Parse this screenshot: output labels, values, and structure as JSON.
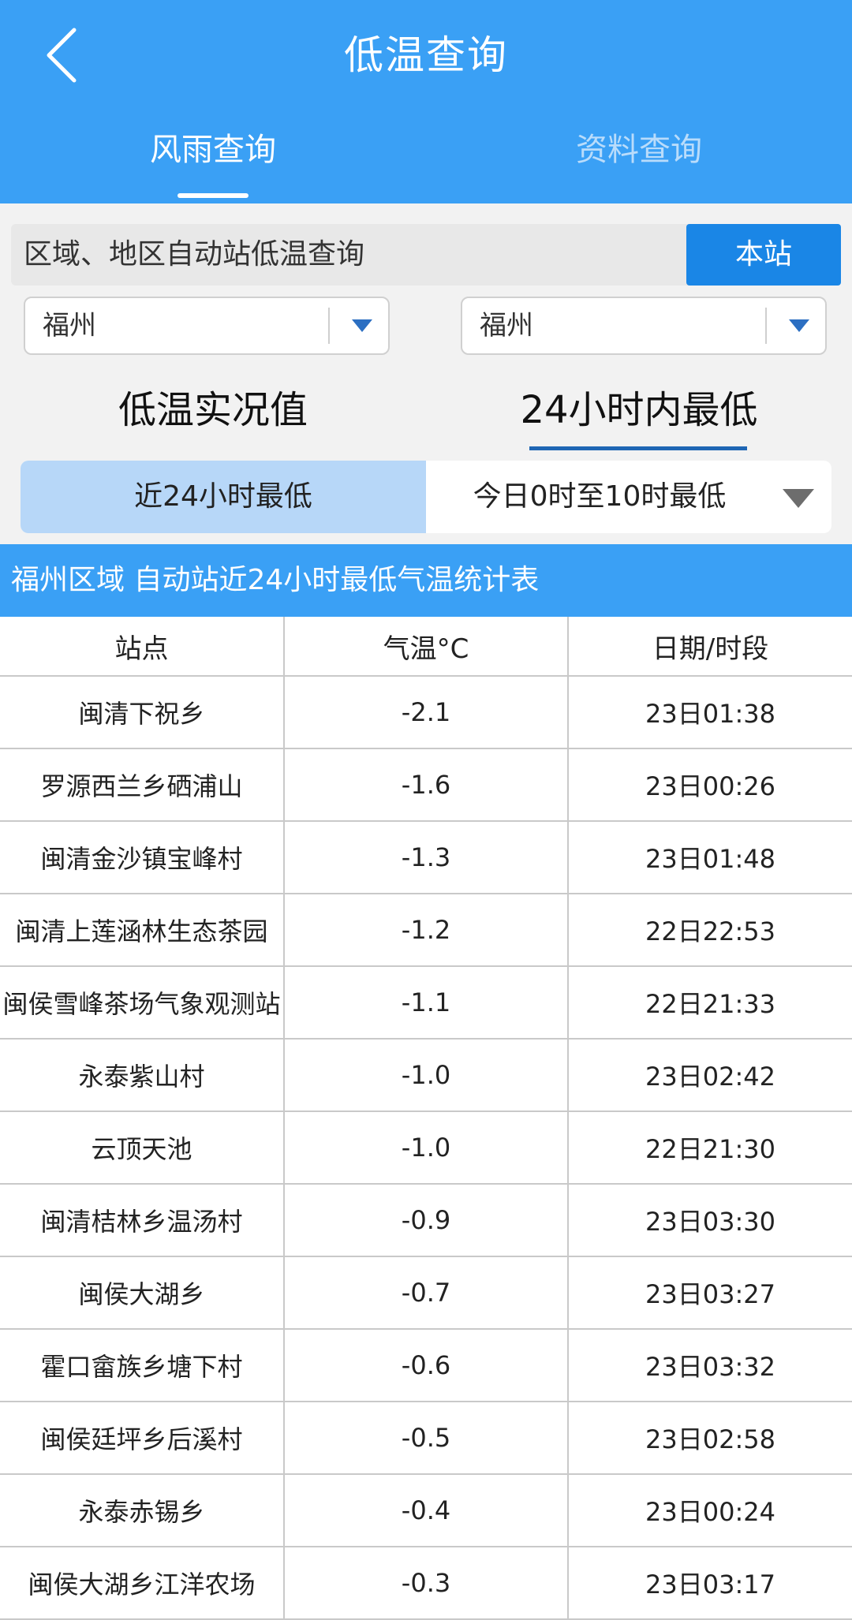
{
  "header": {
    "title": "低温查询",
    "tabs": [
      {
        "label": "风雨查询",
        "active": true
      },
      {
        "label": "资料查询",
        "active": false
      }
    ]
  },
  "search": {
    "label": "区域、地区自动站低温查询",
    "button_label": "本站"
  },
  "selects": {
    "left_value": "福州",
    "right_value": "福州"
  },
  "modes": {
    "left": "低温实况值",
    "right": "24小时内最低",
    "active": "right"
  },
  "range": {
    "left": "近24小时最低",
    "right": "今日0时至10时最低",
    "active": "left"
  },
  "table": {
    "title": "福州区域 自动站近24小时最低气温统计表",
    "headers": [
      "站点",
      "气温°C",
      "日期/时段"
    ],
    "rows": [
      [
        "闽清下祝乡",
        "-2.1",
        "23日01:38"
      ],
      [
        "罗源西兰乡硒浦山",
        "-1.6",
        "23日00:26"
      ],
      [
        "闽清金沙镇宝峰村",
        "-1.3",
        "23日01:48"
      ],
      [
        "闽清上莲涵林生态茶园",
        "-1.2",
        "22日22:53"
      ],
      [
        "闽侯雪峰茶场气象观测站",
        "-1.1",
        "22日21:33"
      ],
      [
        "永泰紫山村",
        "-1.0",
        "23日02:42"
      ],
      [
        "云顶天池",
        "-1.0",
        "22日21:30"
      ],
      [
        "闽清桔林乡温汤村",
        "-0.9",
        "23日03:30"
      ],
      [
        "闽侯大湖乡",
        "-0.7",
        "23日03:27"
      ],
      [
        "霍口畲族乡塘下村",
        "-0.6",
        "23日03:32"
      ],
      [
        "闽侯廷坪乡后溪村",
        "-0.5",
        "23日02:58"
      ],
      [
        "永泰赤锡乡",
        "-0.4",
        "23日00:24"
      ],
      [
        "闽侯大湖乡江洋农场",
        "-0.3",
        "23日03:17"
      ]
    ]
  },
  "colors": {
    "header_bg": "#3aa0f5",
    "button_bg": "#1a86e6",
    "range_active_bg": "#b7d7f8",
    "underline": "#1f66b4"
  },
  "icons": {
    "back": "chevron-left-icon",
    "dropdown": "caret-down-icon"
  }
}
